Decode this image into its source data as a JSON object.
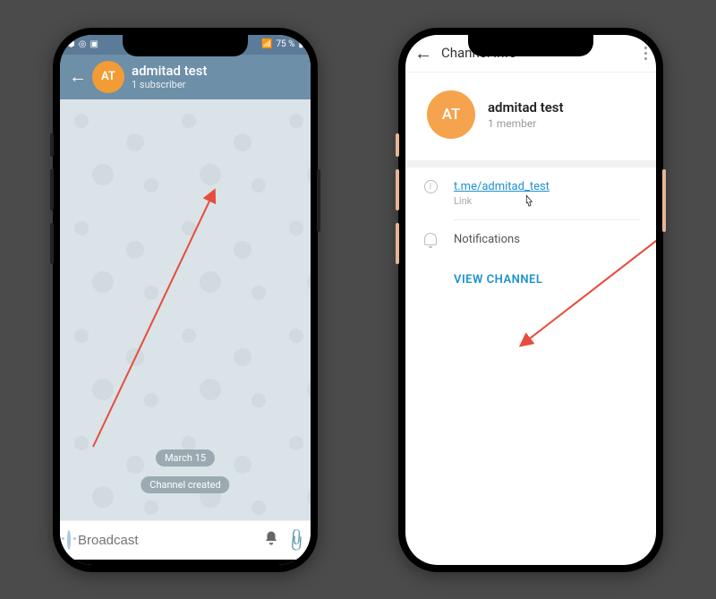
{
  "left": {
    "status": {
      "battery_text": "75 %",
      "battery_icon": "battery-icon",
      "signal_icon": "signal-icon"
    },
    "header": {
      "avatar_initials": "AT",
      "title": "admitad test",
      "subtitle": "1 subscriber"
    },
    "chat": {
      "date_pill": "March 15",
      "system_pill": "Channel created"
    },
    "compose": {
      "placeholder": "Broadcast"
    }
  },
  "right": {
    "header": {
      "title": "Channel Info"
    },
    "profile": {
      "avatar_initials": "AT",
      "name": "admitad test",
      "members": "1 member"
    },
    "link": {
      "url": "t.me/admitad_test",
      "label": "Link"
    },
    "notifications": {
      "label": "Notifications"
    },
    "view_channel": "VIEW CHANNEL"
  }
}
